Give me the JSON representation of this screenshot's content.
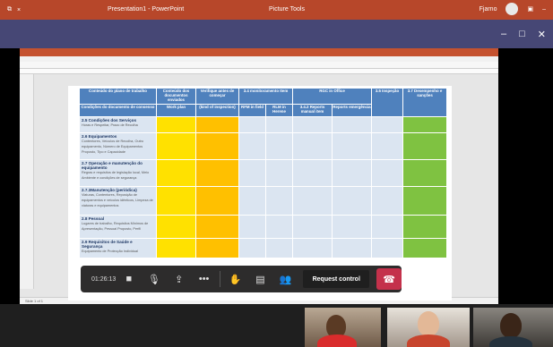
{
  "titlebar": {
    "title": "Presentation1 - PowerPoint",
    "context_tab": "Picture Tools",
    "user": "Fjarno"
  },
  "ppt": {
    "status": "Slide 1 of 1"
  },
  "table": {
    "header_row1": [
      "Conteúdo do plano de trabalho",
      "Conteúdo dos documentos enviados",
      "Verifique antes de começar",
      "3.4 monitoramento Item",
      "RGC in Office",
      "3.5 Inspeção",
      "3.7 Desempenho e sanções"
    ],
    "header_row2": [
      "Condições do documento de consenso",
      "Work plan",
      "(kind of inspection)",
      "RFM in field",
      "RLM in Herene",
      "3.4.2 Reports manual item",
      "Reports emergência"
    ],
    "rows": [
      {
        "title": "2.5 Condições dos Serviços",
        "detail": "Horas e Respeitar, Prazo de Recolha"
      },
      {
        "title": "2.6 Equipamentos",
        "detail": "Contentores, Veículos de Recolha, Outro equipamento, Número de Equipamentos Proposto, Tipo e Capacidade"
      },
      {
        "title": "2.7 Operação e manutenção do equipamento",
        "detail": "Regras e requisitos de legislação local, Meio Ambiente e condições de segurança"
      },
      {
        "title": "2.7.3Manutenção (periódica)",
        "detail": "Viaturas, Contentores, Reposição de equipamentos e veículos idênticos, Limpeza de viaturas e equipamentos"
      },
      {
        "title": "2.8 Pessoal",
        "detail": "Lugares de trabalho, Requisitos Mínimos de Apresentação, Pessoal Proposto, Perfil"
      },
      {
        "title": "2.9 Requisitos de Saúde e Segurança",
        "detail": "Equipamento de Protecção Individual"
      }
    ]
  },
  "controls": {
    "timer": "01:26:13",
    "request_control": "Request control"
  },
  "colors": {
    "header_blue": "#4f81bd",
    "yellow": "#ffe100",
    "orange": "#ffc000",
    "green": "#7fc241",
    "light_blue": "#dbe5f1",
    "teams_red": "#b7472a",
    "teams_purple": "#464775",
    "hangup_red": "#c4314b"
  },
  "icons": [
    "camera-icon",
    "microphone-icon",
    "share-screen-icon",
    "more-icon",
    "raise-hand-icon",
    "chat-icon",
    "participants-icon",
    "hang-up-icon"
  ]
}
